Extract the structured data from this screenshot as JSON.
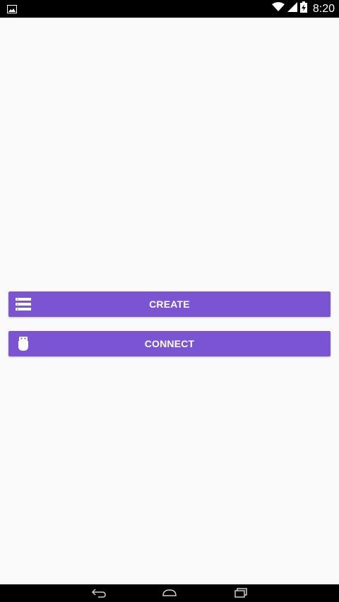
{
  "status_bar": {
    "time": "8:20",
    "icons": [
      "image-notification-icon",
      "wifi-icon",
      "signal-icon",
      "battery-charging-icon"
    ]
  },
  "main": {
    "buttons": [
      {
        "label": "CREATE",
        "icon": "list-icon"
      },
      {
        "label": "CONNECT",
        "icon": "usb-plug-icon"
      }
    ]
  },
  "colors": {
    "accent": "#7b54d3",
    "background": "#fafafa"
  },
  "nav_bar": {
    "icons": [
      "back-icon",
      "home-icon",
      "recent-apps-icon"
    ]
  }
}
